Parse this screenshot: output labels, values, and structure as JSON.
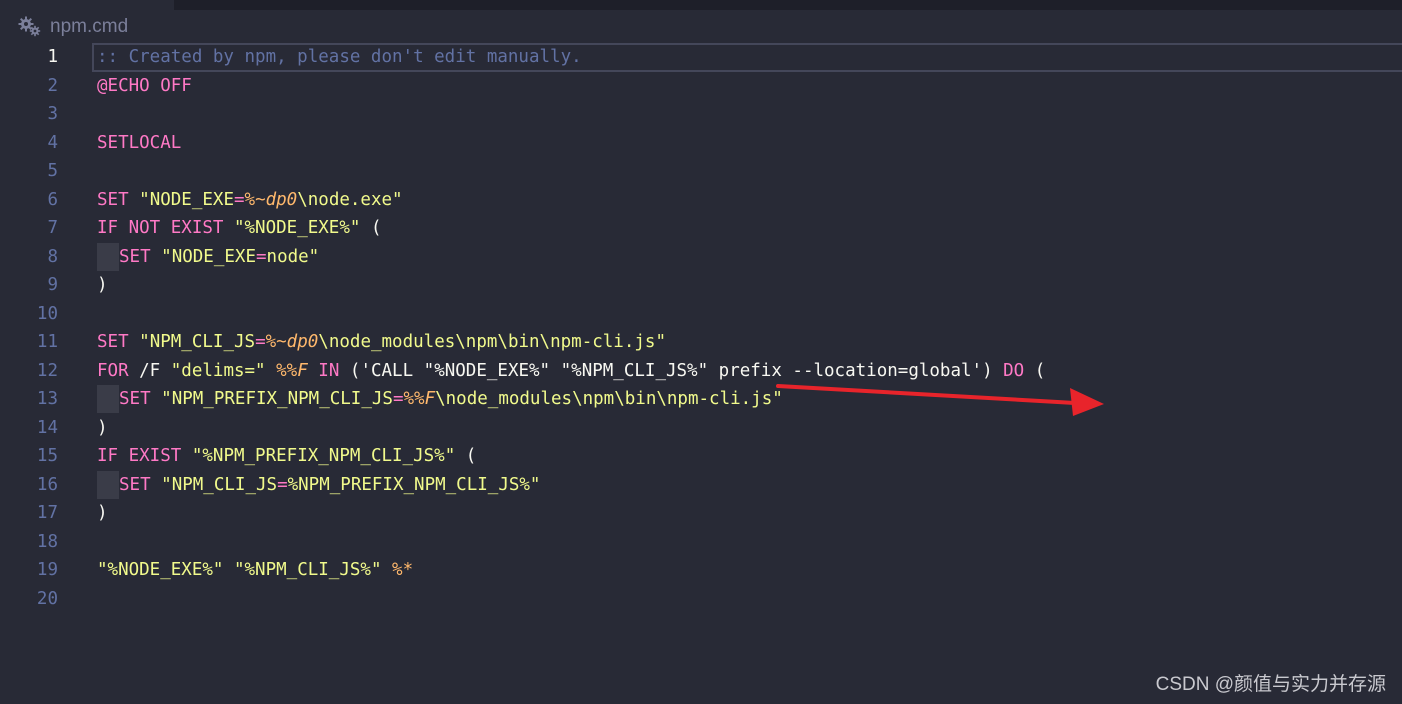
{
  "tab": {
    "icon": "gear-icon",
    "filename": "npm.cmd"
  },
  "editor": {
    "active_line": 1,
    "lines": [
      {
        "number": "1",
        "tokens": [
          {
            "t": "comment",
            "v": ":: Created by npm, please don't edit manually."
          }
        ]
      },
      {
        "number": "2",
        "tokens": [
          {
            "t": "keyword",
            "v": "@ECHO OFF"
          }
        ]
      },
      {
        "number": "3",
        "tokens": []
      },
      {
        "number": "4",
        "tokens": [
          {
            "t": "keyword",
            "v": "SETLOCAL"
          }
        ]
      },
      {
        "number": "5",
        "tokens": []
      },
      {
        "number": "6",
        "tokens": [
          {
            "t": "keyword",
            "v": "SET"
          },
          {
            "t": "plain",
            "v": " "
          },
          {
            "t": "string",
            "v": "\"NODE_EXE"
          },
          {
            "t": "keyword",
            "v": "="
          },
          {
            "t": "var",
            "v": "%~dp0"
          },
          {
            "t": "string",
            "v": "\\node.exe\""
          }
        ]
      },
      {
        "number": "7",
        "tokens": [
          {
            "t": "keyword",
            "v": "IF NOT EXIST"
          },
          {
            "t": "plain",
            "v": " "
          },
          {
            "t": "string",
            "v": "\"%NODE_EXE%\""
          },
          {
            "t": "plain",
            "v": " ("
          }
        ]
      },
      {
        "number": "8",
        "indent": true,
        "tokens": [
          {
            "t": "keyword",
            "v": "SET"
          },
          {
            "t": "plain",
            "v": " "
          },
          {
            "t": "string",
            "v": "\"NODE_EXE"
          },
          {
            "t": "keyword",
            "v": "="
          },
          {
            "t": "string",
            "v": "node\""
          }
        ]
      },
      {
        "number": "9",
        "tokens": [
          {
            "t": "plain",
            "v": ")"
          }
        ]
      },
      {
        "number": "10",
        "tokens": []
      },
      {
        "number": "11",
        "tokens": [
          {
            "t": "keyword",
            "v": "SET"
          },
          {
            "t": "plain",
            "v": " "
          },
          {
            "t": "string",
            "v": "\"NPM_CLI_JS"
          },
          {
            "t": "keyword",
            "v": "="
          },
          {
            "t": "var",
            "v": "%~dp0"
          },
          {
            "t": "string",
            "v": "\\node_modules\\npm\\bin\\npm-cli.js\""
          }
        ]
      },
      {
        "number": "12",
        "tokens": [
          {
            "t": "keyword",
            "v": "FOR"
          },
          {
            "t": "plain",
            "v": " /F "
          },
          {
            "t": "string",
            "v": "\"delims=\""
          },
          {
            "t": "plain",
            "v": " "
          },
          {
            "t": "var",
            "v": "%%F"
          },
          {
            "t": "plain",
            "v": " "
          },
          {
            "t": "keyword",
            "v": "IN"
          },
          {
            "t": "plain",
            "v": " ('CALL \"%NODE_EXE%\" \"%NPM_CLI_JS%\" prefix --location=global') "
          },
          {
            "t": "keyword",
            "v": "DO"
          },
          {
            "t": "plain",
            "v": " ("
          }
        ]
      },
      {
        "number": "13",
        "indent": true,
        "tokens": [
          {
            "t": "keyword",
            "v": "SET"
          },
          {
            "t": "plain",
            "v": " "
          },
          {
            "t": "string",
            "v": "\"NPM_PREFIX_NPM_CLI_JS"
          },
          {
            "t": "keyword",
            "v": "="
          },
          {
            "t": "var",
            "v": "%%F"
          },
          {
            "t": "string",
            "v": "\\node_modules\\npm\\bin\\npm-cli.js\""
          }
        ]
      },
      {
        "number": "14",
        "tokens": [
          {
            "t": "plain",
            "v": ")"
          }
        ]
      },
      {
        "number": "15",
        "tokens": [
          {
            "t": "keyword",
            "v": "IF EXIST"
          },
          {
            "t": "plain",
            "v": " "
          },
          {
            "t": "string",
            "v": "\"%NPM_PREFIX_NPM_CLI_JS%\""
          },
          {
            "t": "plain",
            "v": " ("
          }
        ]
      },
      {
        "number": "16",
        "indent": true,
        "tokens": [
          {
            "t": "keyword",
            "v": "SET"
          },
          {
            "t": "plain",
            "v": " "
          },
          {
            "t": "string",
            "v": "\"NPM_CLI_JS"
          },
          {
            "t": "keyword",
            "v": "="
          },
          {
            "t": "string",
            "v": "%NPM_PREFIX_NPM_CLI_JS%\""
          }
        ]
      },
      {
        "number": "17",
        "tokens": [
          {
            "t": "plain",
            "v": ")"
          }
        ]
      },
      {
        "number": "18",
        "tokens": []
      },
      {
        "number": "19",
        "tokens": [
          {
            "t": "string",
            "v": "\"%NODE_EXE%\""
          },
          {
            "t": "plain",
            "v": " "
          },
          {
            "t": "string",
            "v": "\"%NPM_CLI_JS%\""
          },
          {
            "t": "plain",
            "v": " "
          },
          {
            "t": "var",
            "v": "%*"
          }
        ]
      },
      {
        "number": "20",
        "tokens": []
      }
    ]
  },
  "annotation": {
    "color": "#e8242b"
  },
  "watermark": {
    "text": "CSDN @颜值与实力并存源"
  },
  "colors": {
    "background": "#282a36",
    "comment": "#6272a4",
    "keyword": "#ff79c6",
    "string": "#f1fa8c",
    "variable": "#ffb86c",
    "text": "#f8f8f2"
  }
}
